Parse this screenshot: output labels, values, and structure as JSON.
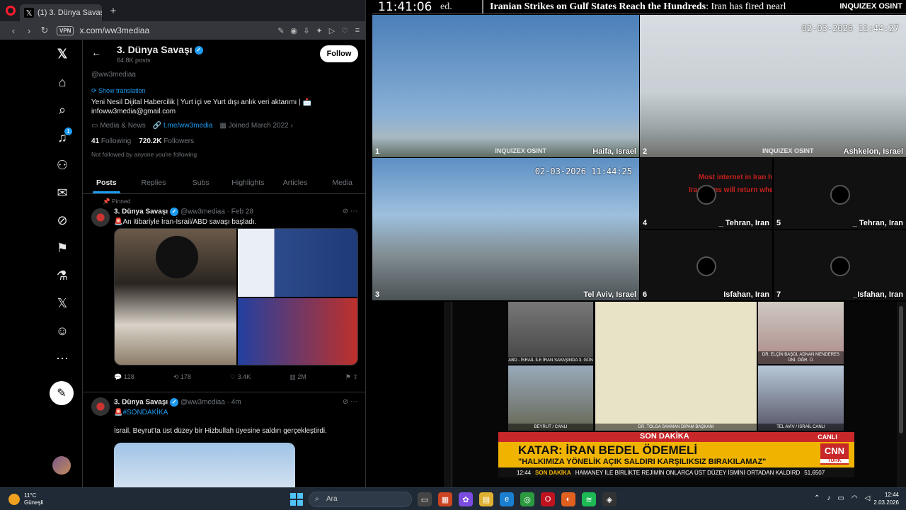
{
  "browser": {
    "tab_title": "(1) 3. Dünya Savaşı (@ww",
    "url": "x.com/ww3mediaa",
    "vpn": "VPN"
  },
  "profile": {
    "name": "3. Dünya Savaşı",
    "posts": "64.8K posts",
    "handle": "@ww3mediaa",
    "follow": "Follow",
    "show_translation": "Show translation",
    "bio": "Yeni Nesil Dijital Habercilik | Yurt içi ve Yurt dışı anlık veri aktarımı | 📩 infoww3media@gmail.com",
    "category": "Media & News",
    "link": "t.me/ww3media",
    "joined": "Joined March 2022",
    "following_count": "41",
    "following_label": "Following",
    "followers_count": "720.2K",
    "followers_label": "Followers",
    "not_followed": "Not followed by anyone you're following"
  },
  "tabs": [
    "Posts",
    "Replies",
    "Subs",
    "Highlights",
    "Articles",
    "Media"
  ],
  "tweets": [
    {
      "pinned": "Pinned",
      "name": "3. Dünya Savaşı",
      "meta": "@ww3mediaa · Feb 28",
      "text": "🚨An itibariyle İran-İsrail/ABD savaşı başladı.",
      "replies": "128",
      "reposts": "178",
      "likes": "3.4K",
      "views": "2M"
    },
    {
      "name": "3. Dünya Savaşı",
      "meta": "@ww3mediaa · 4m",
      "text": "🚨#SONDAKİKA",
      "text2": "İsrail, Beyrut'ta üst düzey bir Hizbullah üyesine saldırı gerçekleştirdi."
    }
  ],
  "ticker": {
    "clock": "11:41:06",
    "fragment": "ed.",
    "headline": "Iranian Strikes on Gulf States Reach the Hundreds",
    "rest": ": Iran has fired nearl",
    "logo": "INQUIZEX OSINT"
  },
  "cams": [
    {
      "num": "1",
      "loc": "Haifa, Israel",
      "wm": "INQUIZEX OSINT"
    },
    {
      "num": "2",
      "loc": "Ashkelon, Israel",
      "ts": "02-03-2026 11:44:27",
      "wm": "INQUIZEX OSINT"
    },
    {
      "num": "3",
      "loc": "Tel Aviv, Israel",
      "ts": "02-03-2026 11:44:25"
    },
    {
      "num": "4",
      "loc": "_ Tehran, Iran"
    },
    {
      "num": "5",
      "loc": "_ Tehran, Iran"
    },
    {
      "num": "6",
      "loc": "Isfahan, Iran"
    },
    {
      "num": "7",
      "loc": "_Isfahan, Iran"
    }
  ],
  "cam_notice_1": "Most internet in Iran has been shutdown.",
  "cam_notice_2": "Iran cams will return when internet is restored.",
  "news": {
    "cap1": "ABD - İSRAİL İLE İRAN SAVAŞINDA 3. GÜN",
    "cap2": "BEYRUT / CANLI",
    "cap3": "DR. TOLGA SAKMAN DİPAM BAŞKANI",
    "cap4": "DR. ELÇİN BAŞOL ADNAN MENDERES ÜNİ. ÖĞR. Ü.",
    "cap5": "TEL AVİV / İSRAİL CANLI",
    "son_dakika": "SON DAKİKA",
    "canli": "CANLI",
    "headline": "KATAR: İRAN BEDEL ÖDEMELİ",
    "subheadline": "\"HALKIMIZA YÖNELİK AÇIK SALDIRI KARŞILIKSIZ BIRAKILAMAZ\"",
    "cnn": "CNN",
    "turk": "TÜRK",
    "crawl_time": "12:44",
    "crawl_sd": "SON DAKİKA",
    "crawl_text": "HAMANEY İLE BİRLİKTE REJİMİN ONLARCA ÜST DÜZEY İSMİNİ ORTADAN KALDIRD",
    "crawl_index": "51,6507"
  },
  "taskbar": {
    "temp": "11°C",
    "weather": "Güneşli",
    "search": "Ara",
    "time": "12:44",
    "date": "2.03.2026"
  },
  "colors": {
    "accent": "#1d9bf0",
    "news_red": "#c9282a",
    "news_yellow": "#f0b400"
  }
}
